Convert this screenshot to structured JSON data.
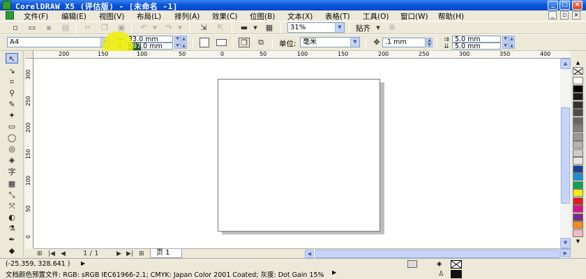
{
  "titlebar": {
    "title": "CorelDRAW X5 (评估版) - [未命名 -1]",
    "minimize_glyph": "_",
    "maximize_glyph": "□",
    "close_glyph": "×"
  },
  "menubar": {
    "items": [
      "文件(F)",
      "编辑(E)",
      "视图(V)",
      "布局(L)",
      "排列(A)",
      "效果(C)",
      "位图(B)",
      "文本(X)",
      "表格(T)",
      "工具(O)",
      "窗口(W)",
      "帮助(H)"
    ],
    "mdi_minimize_glyph": "_",
    "mdi_restore_glyph": "▫",
    "mdi_close_glyph": "×"
  },
  "toolbar1": {
    "zoom_value": "31%",
    "snap_label": "贴齐"
  },
  "toolbar2": {
    "paper_size": "A4",
    "page_width": "33.0 mm",
    "page_height_selected": "297",
    "page_height_rest": ".0 mm",
    "units_label": "单位:",
    "units_value": "毫米",
    "nudge_value": ".1 mm",
    "dup_x": "5.0 mm",
    "dup_y": "5.0 mm"
  },
  "hruler": {
    "labels": [
      "200",
      "150",
      "100",
      "50",
      "0",
      "50",
      "100",
      "150",
      "200",
      "250",
      "300",
      "350",
      "400"
    ]
  },
  "vruler": {
    "labels": [
      "300",
      "250",
      "200",
      "150",
      "100",
      "50",
      "0"
    ]
  },
  "pagebar": {
    "page_counter": "1 / 1",
    "page_tab_label": "页 1"
  },
  "statusbar": {
    "coordinates": "(-25.359, 328.641 )",
    "coordinates_arrow": "▶",
    "color_profile": "文档颜色预置文件: RGB: sRGB IEC61966-2.1; CMYK: Japan Color 2001 Coated; 灰度: Dot Gain 15%",
    "profile_arrow": "▶"
  },
  "palette": {
    "colors": [
      "#ffffff",
      "#000000",
      "#1a1a1a",
      "#333333",
      "#4d4d4d",
      "#666666",
      "#808080",
      "#999999",
      "#b3b3b3",
      "#cccccc",
      "#e6e6e6",
      "#1b3f9a",
      "#1c8fd4",
      "#0ea15a",
      "#f4ec1a",
      "#e21b23",
      "#d6148c",
      "#7a2b8e",
      "#f08b1d",
      "#f4b8c6"
    ]
  },
  "colors": {
    "title_blue": "#0a53d8",
    "chrome": "#ece9d8",
    "highlight": "#f0f000"
  }
}
